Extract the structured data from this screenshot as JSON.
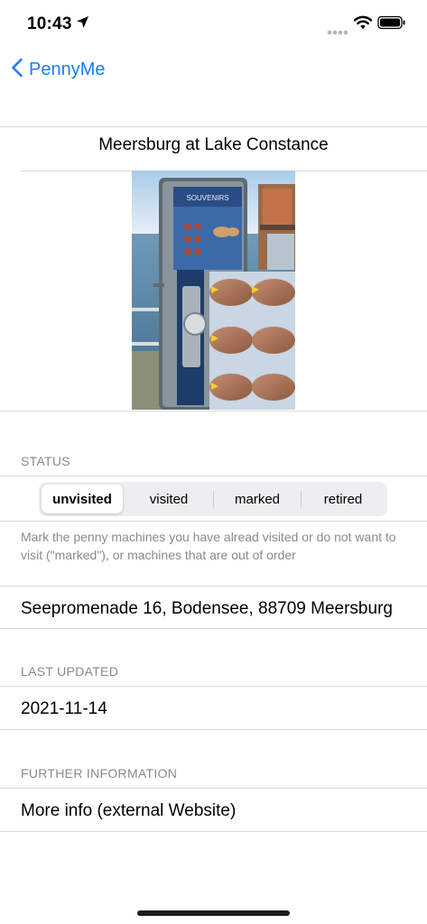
{
  "status_bar": {
    "time": "10:43"
  },
  "nav": {
    "back_label": "PennyMe"
  },
  "location": {
    "title": "Meersburg at Lake Constance",
    "image_label": "SOUVENIRS"
  },
  "status_section": {
    "header": "STATUS",
    "options": [
      "unvisited",
      "visited",
      "marked",
      "retired"
    ],
    "selected": "unvisited",
    "footer": "Mark the penny machines you have alread visited or do not want to visit (\"marked\"), or machines that are out of order"
  },
  "address": "Seepromenade 16, Bodensee, 88709 Meersburg",
  "last_updated": {
    "header": "LAST UPDATED",
    "value": "2021-11-14"
  },
  "further_info": {
    "header": "FURTHER INFORMATION",
    "link_label": "More info (external Website)"
  },
  "colors": {
    "accent": "#1a7cf5",
    "secondary_text": "#8a8a8e",
    "separator": "#d9d9de"
  }
}
